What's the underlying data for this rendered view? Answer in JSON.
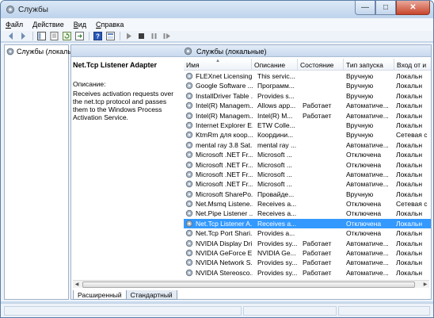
{
  "window": {
    "title": "Службы"
  },
  "menu": [
    {
      "label": "Файл",
      "mnemonic": "Ф",
      "rest": "айл"
    },
    {
      "label": "Действие",
      "mnemonic": "Д",
      "rest": "ействие"
    },
    {
      "label": "Вид",
      "mnemonic": "В",
      "rest": "ид"
    },
    {
      "label": "Справка",
      "mnemonic": "С",
      "rest": "правка"
    }
  ],
  "toolbar": {
    "icons": [
      "back-icon",
      "forward-icon",
      "show-tree-icon",
      "properties-icon",
      "refresh-icon",
      "export-icon",
      "help-icon",
      "mmc-icon",
      "start-icon",
      "stop-icon",
      "pause-icon",
      "restart-icon"
    ]
  },
  "tree": {
    "item_label": "Службы (локальны"
  },
  "pane": {
    "header_title": "Службы (локальные)"
  },
  "description": {
    "service_name": "Net.Tcp Listener Adapter",
    "label": "Описание:",
    "text": "Receives activation requests over the net.tcp protocol and passes them to the Windows Process Activation Service."
  },
  "table": {
    "columns": [
      "Имя",
      "Описание",
      "Состояние",
      "Тип запуска",
      "Вход от и"
    ],
    "rows": [
      {
        "name": "FLEXnet Licensing...",
        "description": "This servic...",
        "state": "",
        "startup": "Вручную",
        "logon": "Локальн"
      },
      {
        "name": "Google Software ...",
        "description": "Программ...",
        "state": "",
        "startup": "Вручную",
        "logon": "Локальн"
      },
      {
        "name": "InstallDriver Table ...",
        "description": "Provides s...",
        "state": "",
        "startup": "Вручную",
        "logon": "Локальн"
      },
      {
        "name": "Intel(R) Managem...",
        "description": "Allows app...",
        "state": "Работает",
        "startup": "Автоматиче...",
        "logon": "Локальн"
      },
      {
        "name": "Intel(R) Managem...",
        "description": "Intel(R) M...",
        "state": "Работает",
        "startup": "Автоматиче...",
        "logon": "Локальн"
      },
      {
        "name": "Internet Explorer E...",
        "description": "ETW Colle...",
        "state": "",
        "startup": "Вручную",
        "logon": "Локальн"
      },
      {
        "name": "KtmRm для коор...",
        "description": "Координи...",
        "state": "",
        "startup": "Вручную",
        "logon": "Сетевая с"
      },
      {
        "name": "mental ray 3.8 Sat...",
        "description": "mental ray ...",
        "state": "",
        "startup": "Автоматиче...",
        "logon": "Локальн"
      },
      {
        "name": "Microsoft .NET Fr...",
        "description": "Microsoft ...",
        "state": "",
        "startup": "Отключена",
        "logon": "Локальн"
      },
      {
        "name": "Microsoft .NET Fr...",
        "description": "Microsoft ...",
        "state": "",
        "startup": "Отключена",
        "logon": "Локальн"
      },
      {
        "name": "Microsoft .NET Fr...",
        "description": "Microsoft ...",
        "state": "",
        "startup": "Автоматиче...",
        "logon": "Локальн"
      },
      {
        "name": "Microsoft .NET Fr...",
        "description": "Microsoft ...",
        "state": "",
        "startup": "Автоматиче...",
        "logon": "Локальн"
      },
      {
        "name": "Microsoft SharePo...",
        "description": "Провайде...",
        "state": "",
        "startup": "Вручную",
        "logon": "Локальн"
      },
      {
        "name": "Net.Msmq Listene...",
        "description": "Receives a...",
        "state": "",
        "startup": "Отключена",
        "logon": "Сетевая с"
      },
      {
        "name": "Net.Pipe Listener ...",
        "description": "Receives a...",
        "state": "",
        "startup": "Отключена",
        "logon": "Локальн"
      },
      {
        "name": "Net.Tcp Listener A...",
        "description": "Receives a...",
        "state": "",
        "startup": "Отключена",
        "logon": "Локальн",
        "selected": true
      },
      {
        "name": "Net.Tcp Port Shari...",
        "description": "Provides a...",
        "state": "",
        "startup": "Отключена",
        "logon": "Локальн"
      },
      {
        "name": "NVIDIA Display Dri...",
        "description": "Provides sy...",
        "state": "Работает",
        "startup": "Автоматиче...",
        "logon": "Локальн"
      },
      {
        "name": "NVIDIA GeForce E...",
        "description": "NVIDIA Ge...",
        "state": "Работает",
        "startup": "Автоматиче...",
        "logon": "Локальн"
      },
      {
        "name": "NVIDIA Network S...",
        "description": "Provides sy...",
        "state": "Работает",
        "startup": "Автоматиче...",
        "logon": "Локальн"
      },
      {
        "name": "NVIDIA Stereosco...",
        "description": "Provides sy...",
        "state": "Работает",
        "startup": "Автоматиче...",
        "logon": "Локальн"
      }
    ]
  },
  "tabs": [
    {
      "label": "Расширенный",
      "active": true
    },
    {
      "label": "Стандартный",
      "active": false
    }
  ],
  "colors": {
    "selection": "#3399ff",
    "window_frame": "#c9dcf0"
  }
}
